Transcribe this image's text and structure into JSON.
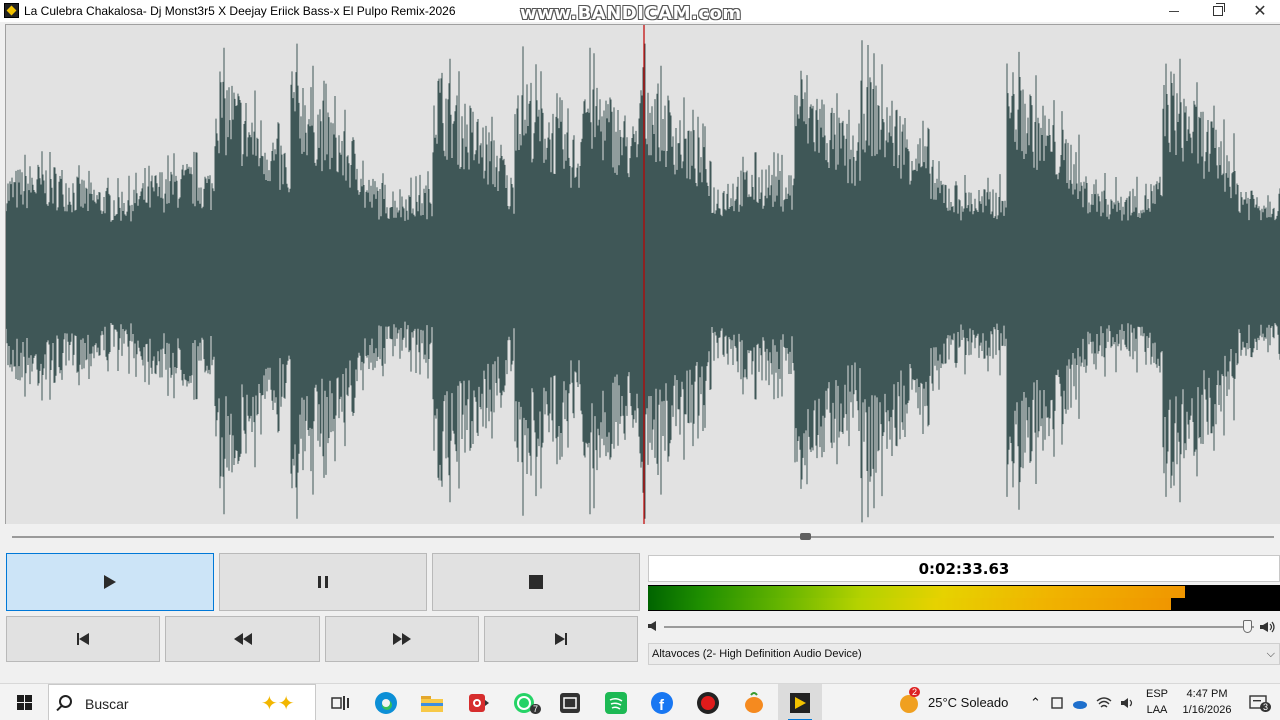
{
  "window": {
    "title": "La Culebra Chakalosa- Dj Monst3r5 X Deejay Eriick Bass-x El Pulpo Remix-2026",
    "watermark": "www.BANDICAM.com",
    "controls": [
      "minimize-icon",
      "maximize-icon",
      "close-icon"
    ]
  },
  "player": {
    "time": "0:02:33.63",
    "seek_position": 0.63,
    "buttons_row1": [
      "play-icon",
      "pause-icon",
      "stop-icon"
    ],
    "buttons_row2": [
      "previous-track-icon",
      "rewind-icon",
      "fast-forward-icon",
      "next-track-icon"
    ],
    "level_meter": {
      "channel_left": 0.849,
      "channel_right": 0.828
    },
    "volume": 0.99,
    "output_device": "Altavoces (2- High Definition Audio Device)",
    "colors": {
      "waveform": "#3f5757",
      "playhead": "#c00000",
      "background": "#e2e2e2"
    }
  },
  "taskbar": {
    "search_placeholder": "Buscar",
    "apps": [
      "task-view-icon",
      "edge-icon",
      "file-explorer-icon",
      "media-app-icon",
      "whatsapp-icon",
      "capture-app-icon",
      "spotify-icon",
      "facebook-icon",
      "record-icon",
      "fl-studio-icon",
      "media-player-icon"
    ],
    "whatsapp_badge": "7",
    "weather_badge": "2",
    "weather": "25°C  Soleado",
    "language_line1": "ESP",
    "language_line2": "LAA",
    "time": "4:47 PM",
    "date": "1/16/2026",
    "notifications_badge": "3"
  }
}
